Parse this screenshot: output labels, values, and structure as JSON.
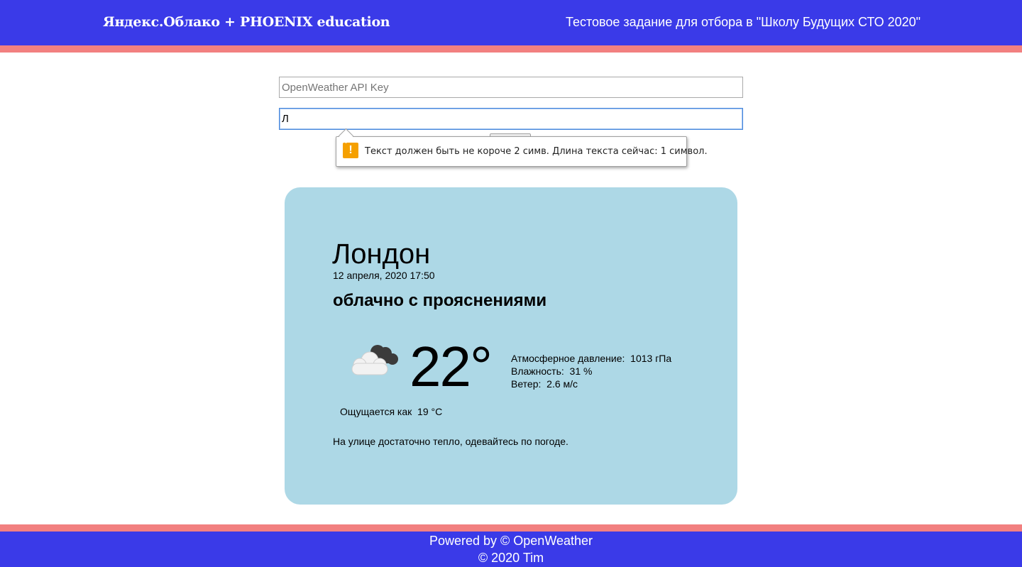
{
  "header": {
    "brand": "Яндекс.Облако + PHOENIX education",
    "tagline": "Тестовое задание для отбора в \"Школу Будущих СТО 2020\""
  },
  "form": {
    "api_key": {
      "value": "",
      "placeholder": "OpenWeather API Key"
    },
    "city": {
      "value": "Л",
      "placeholder": ""
    }
  },
  "validation_tooltip": {
    "icon": "warning-icon",
    "text": "Текст должен быть не короче 2 симв. Длина текста сейчас: 1 символ."
  },
  "weather": {
    "city": "Лондон",
    "datetime": "12 апреля, 2020 17:50",
    "description": "облачно с прояснениями",
    "icon": "partly-cloudy-icon",
    "temperature": "22°",
    "pressure": "Атмосферное давление:  1013 гПа",
    "humidity": "Влажность:  31 %",
    "wind": "Ветер:  2.6 м/с",
    "feels_like": "Ощущается как  19 °C",
    "advice": "На улице достаточно тепло, одевайтесь по погоде."
  },
  "footer": {
    "line1": "Powered by © OpenWeather",
    "line2": "© 2020 Tim"
  },
  "colors": {
    "header_bg": "#3a3ae8",
    "stripe": "#f28080",
    "card_bg": "#add8e6",
    "warning": "#f5a000"
  }
}
